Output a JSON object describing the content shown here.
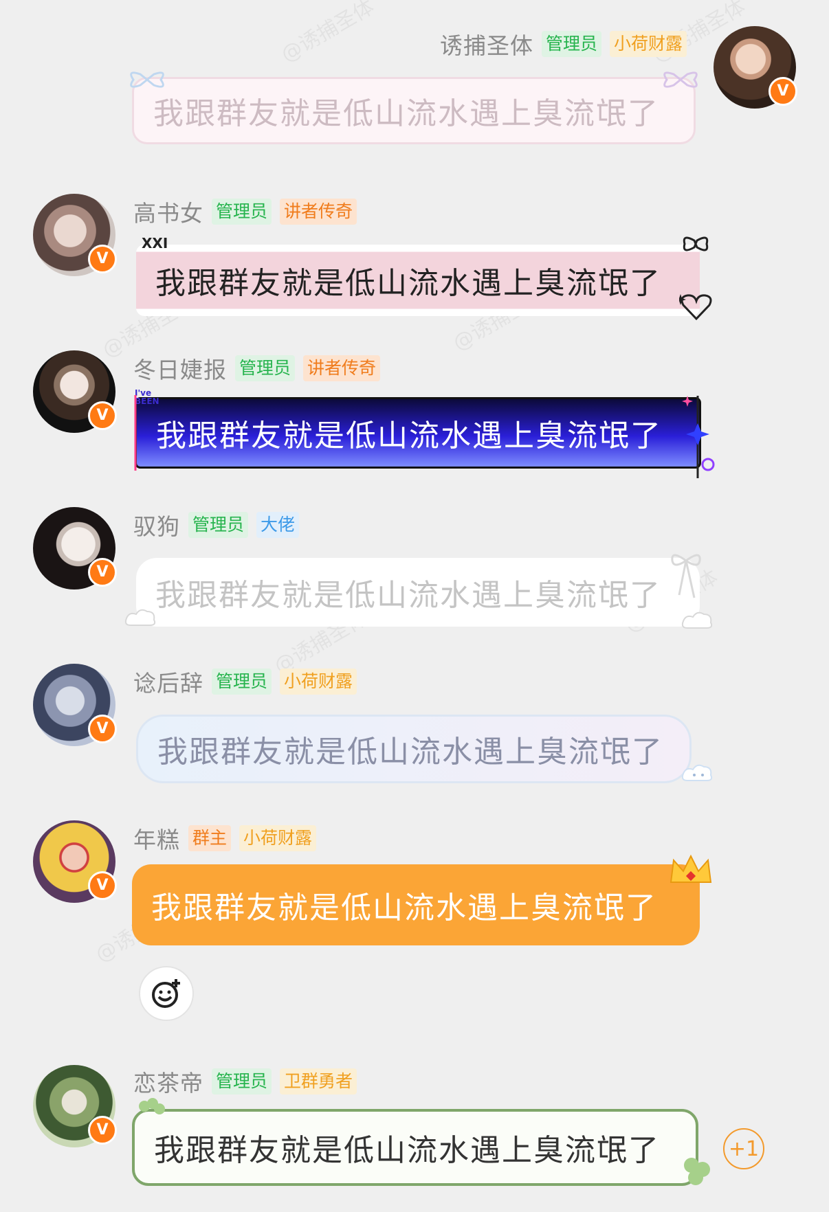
{
  "watermark": "@诱捕圣体",
  "bubble_text": "我跟群友就是低山流水遇上臭流氓了",
  "messages": [
    {
      "name": "诱捕圣体",
      "tags": [
        "管理员",
        "小荷财露"
      ],
      "side": "right",
      "badge": "V"
    },
    {
      "name": "高书女",
      "tags": [
        "管理员",
        "讲者传奇"
      ],
      "side": "left",
      "badge": "V",
      "sticker_text": "XXI"
    },
    {
      "name": "冬日婕报",
      "tags": [
        "管理员",
        "讲者传奇"
      ],
      "side": "left",
      "badge": "V",
      "sticker_text": "I've BEEN"
    },
    {
      "name": "驭狗",
      "tags": [
        "管理员",
        "大佬"
      ],
      "side": "left",
      "badge": "V"
    },
    {
      "name": "谂后辞",
      "tags": [
        "管理员",
        "小荷财露"
      ],
      "side": "left",
      "badge": "V"
    },
    {
      "name": "年糕",
      "tags": [
        "群主",
        "小荷财露"
      ],
      "side": "left",
      "badge": "V"
    },
    {
      "name": "恋茶帝",
      "tags": [
        "管理员",
        "卫群勇者"
      ],
      "side": "left",
      "badge": "V"
    }
  ],
  "reaction_count": "+1",
  "colors": {
    "background": "#efefef",
    "admin_tag": "#27b44e",
    "owner_tag": "#f07c1c",
    "gold_tag": "#f0a020",
    "blue_tag": "#3d9ae8",
    "vip_badge": "#ff7a14",
    "orange_bubble": "#fba536",
    "navy_bubble": "#2a1fd8"
  },
  "icons": [
    "add-emoji-icon",
    "crown-icon",
    "bow-icon",
    "heart-icon",
    "sparkle-icon",
    "clover-icon",
    "cloud-icon"
  ]
}
